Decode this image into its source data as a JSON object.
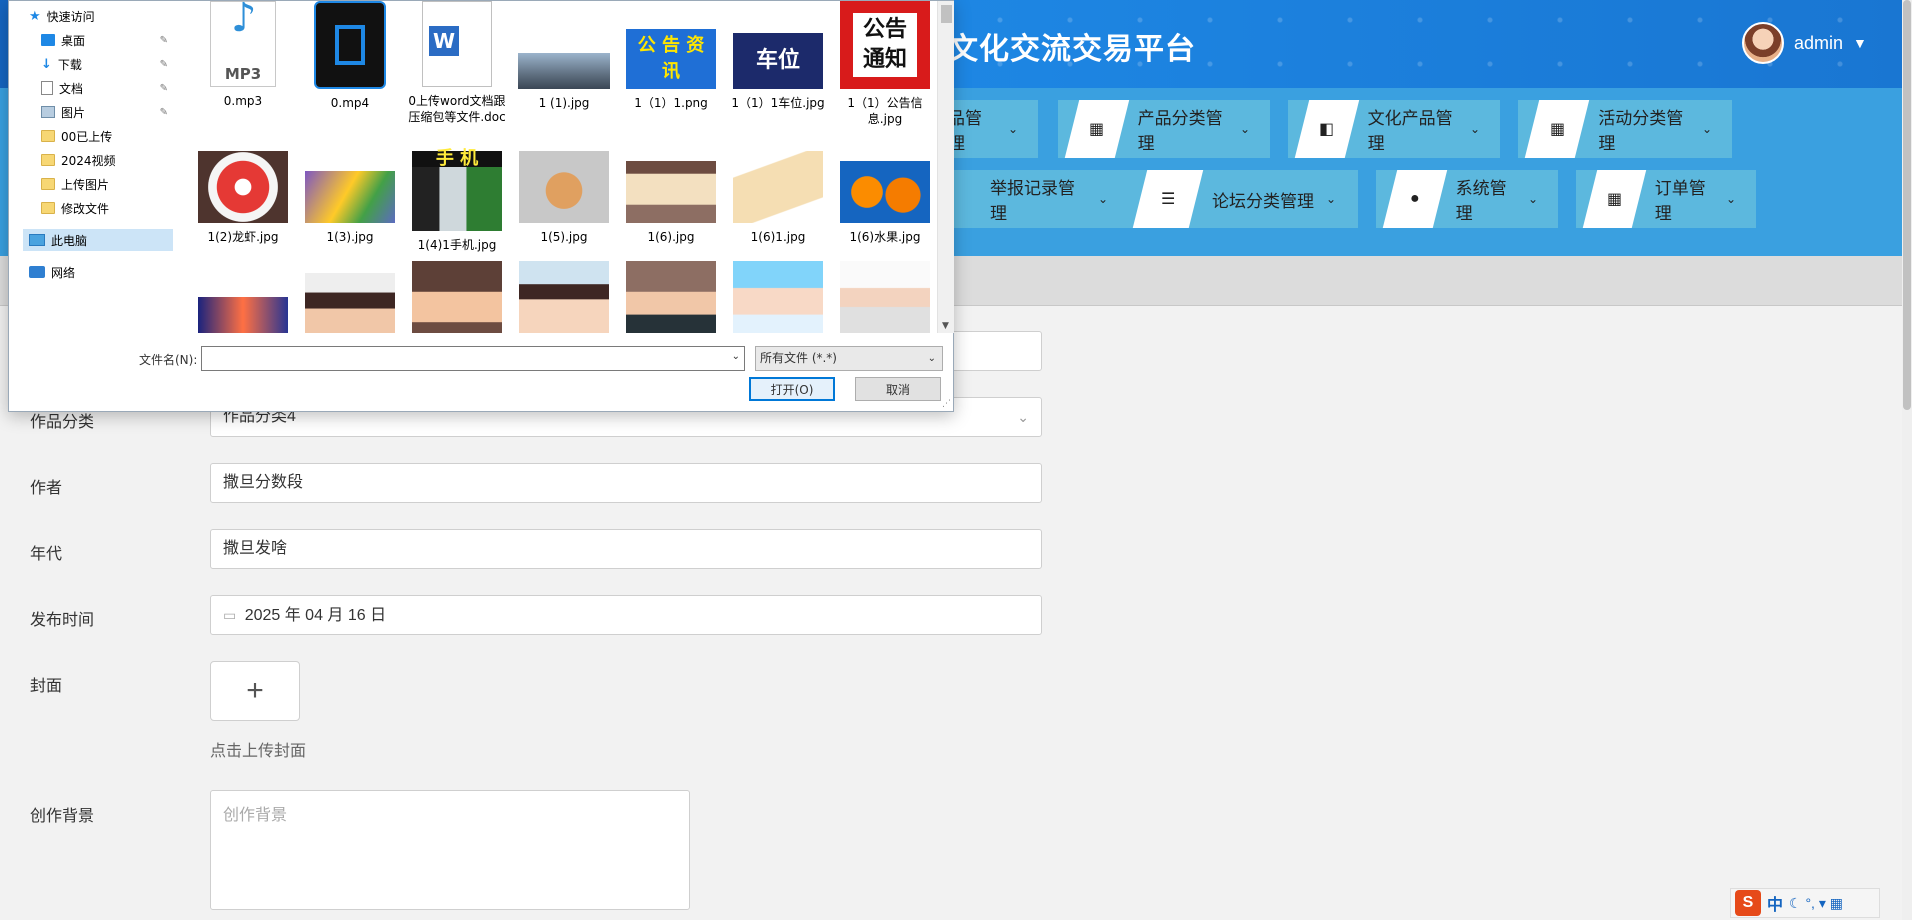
{
  "header": {
    "platform_title": "文化交流交易平台",
    "username": "admin"
  },
  "nav": {
    "items": [
      {
        "label": "品管理"
      },
      {
        "label": "产品分类管理"
      },
      {
        "label": "文化产品管理"
      },
      {
        "label": "活动分类管理"
      },
      {
        "label": "举报记录管理"
      },
      {
        "label": "论坛分类管理"
      },
      {
        "label": "系统管理"
      },
      {
        "label": "订单管理"
      }
    ]
  },
  "form": {
    "category_label": "作品分类",
    "category_value": "作品分类4",
    "author_label": "作者",
    "author_value": "撒旦分数段",
    "era_label": "年代",
    "era_value": "撒旦发啥",
    "publish_label": "发布时间",
    "publish_value": "2025 年 04 月 16 日",
    "cover_label": "封面",
    "cover_plus": "+",
    "cover_hint": "点击上传封面",
    "background_label": "创作背景",
    "background_placeholder": "创作背景"
  },
  "dialog": {
    "tree": [
      {
        "label": "快速访问"
      },
      {
        "label": "桌面"
      },
      {
        "label": "下载"
      },
      {
        "label": "文档"
      },
      {
        "label": "图片"
      },
      {
        "label": "00已上传"
      },
      {
        "label": "2024视频"
      },
      {
        "label": "上传图片"
      },
      {
        "label": "修改文件"
      },
      {
        "label": "此电脑"
      },
      {
        "label": "网络"
      }
    ],
    "files": [
      {
        "name": "0.mp3",
        "thumb_text": "MP3"
      },
      {
        "name": "0.mp4"
      },
      {
        "name": "0上传word文档跟压缩包等文件.doc",
        "thumb_text": "W"
      },
      {
        "name": "1 (1).jpg"
      },
      {
        "name": "1（1）1.png",
        "thumb_text": "公 告 资 讯"
      },
      {
        "name": "1（1）1车位.jpg",
        "thumb_text": "车位"
      },
      {
        "name": "1（1）公告信息.jpg",
        "thumb_text": "公告通知"
      },
      {
        "name": "1(2)龙虾.jpg"
      },
      {
        "name": "1(3).jpg"
      },
      {
        "name": "1(4)1手机.jpg",
        "thumb_text": "手 机"
      },
      {
        "name": "1(5).jpg"
      },
      {
        "name": "1(6).jpg"
      },
      {
        "name": "1(6)1.jpg"
      },
      {
        "name": "1(6)水果.jpg"
      }
    ],
    "filename_label": "文件名(N):",
    "filename_value": "",
    "filetype_value": "所有文件 (*.*)",
    "open_button": "打开(O)",
    "cancel_button": "取消"
  },
  "ime": {
    "s_label": "S",
    "zh_label": "中",
    "tray_symbols": "☾ °, ▾ ▦"
  },
  "colors": {
    "header_blue": "#1976d2",
    "nav_blue": "#3aa0e0",
    "nav_item": "#5cb8de",
    "dialog_accent": "#0078d7"
  }
}
